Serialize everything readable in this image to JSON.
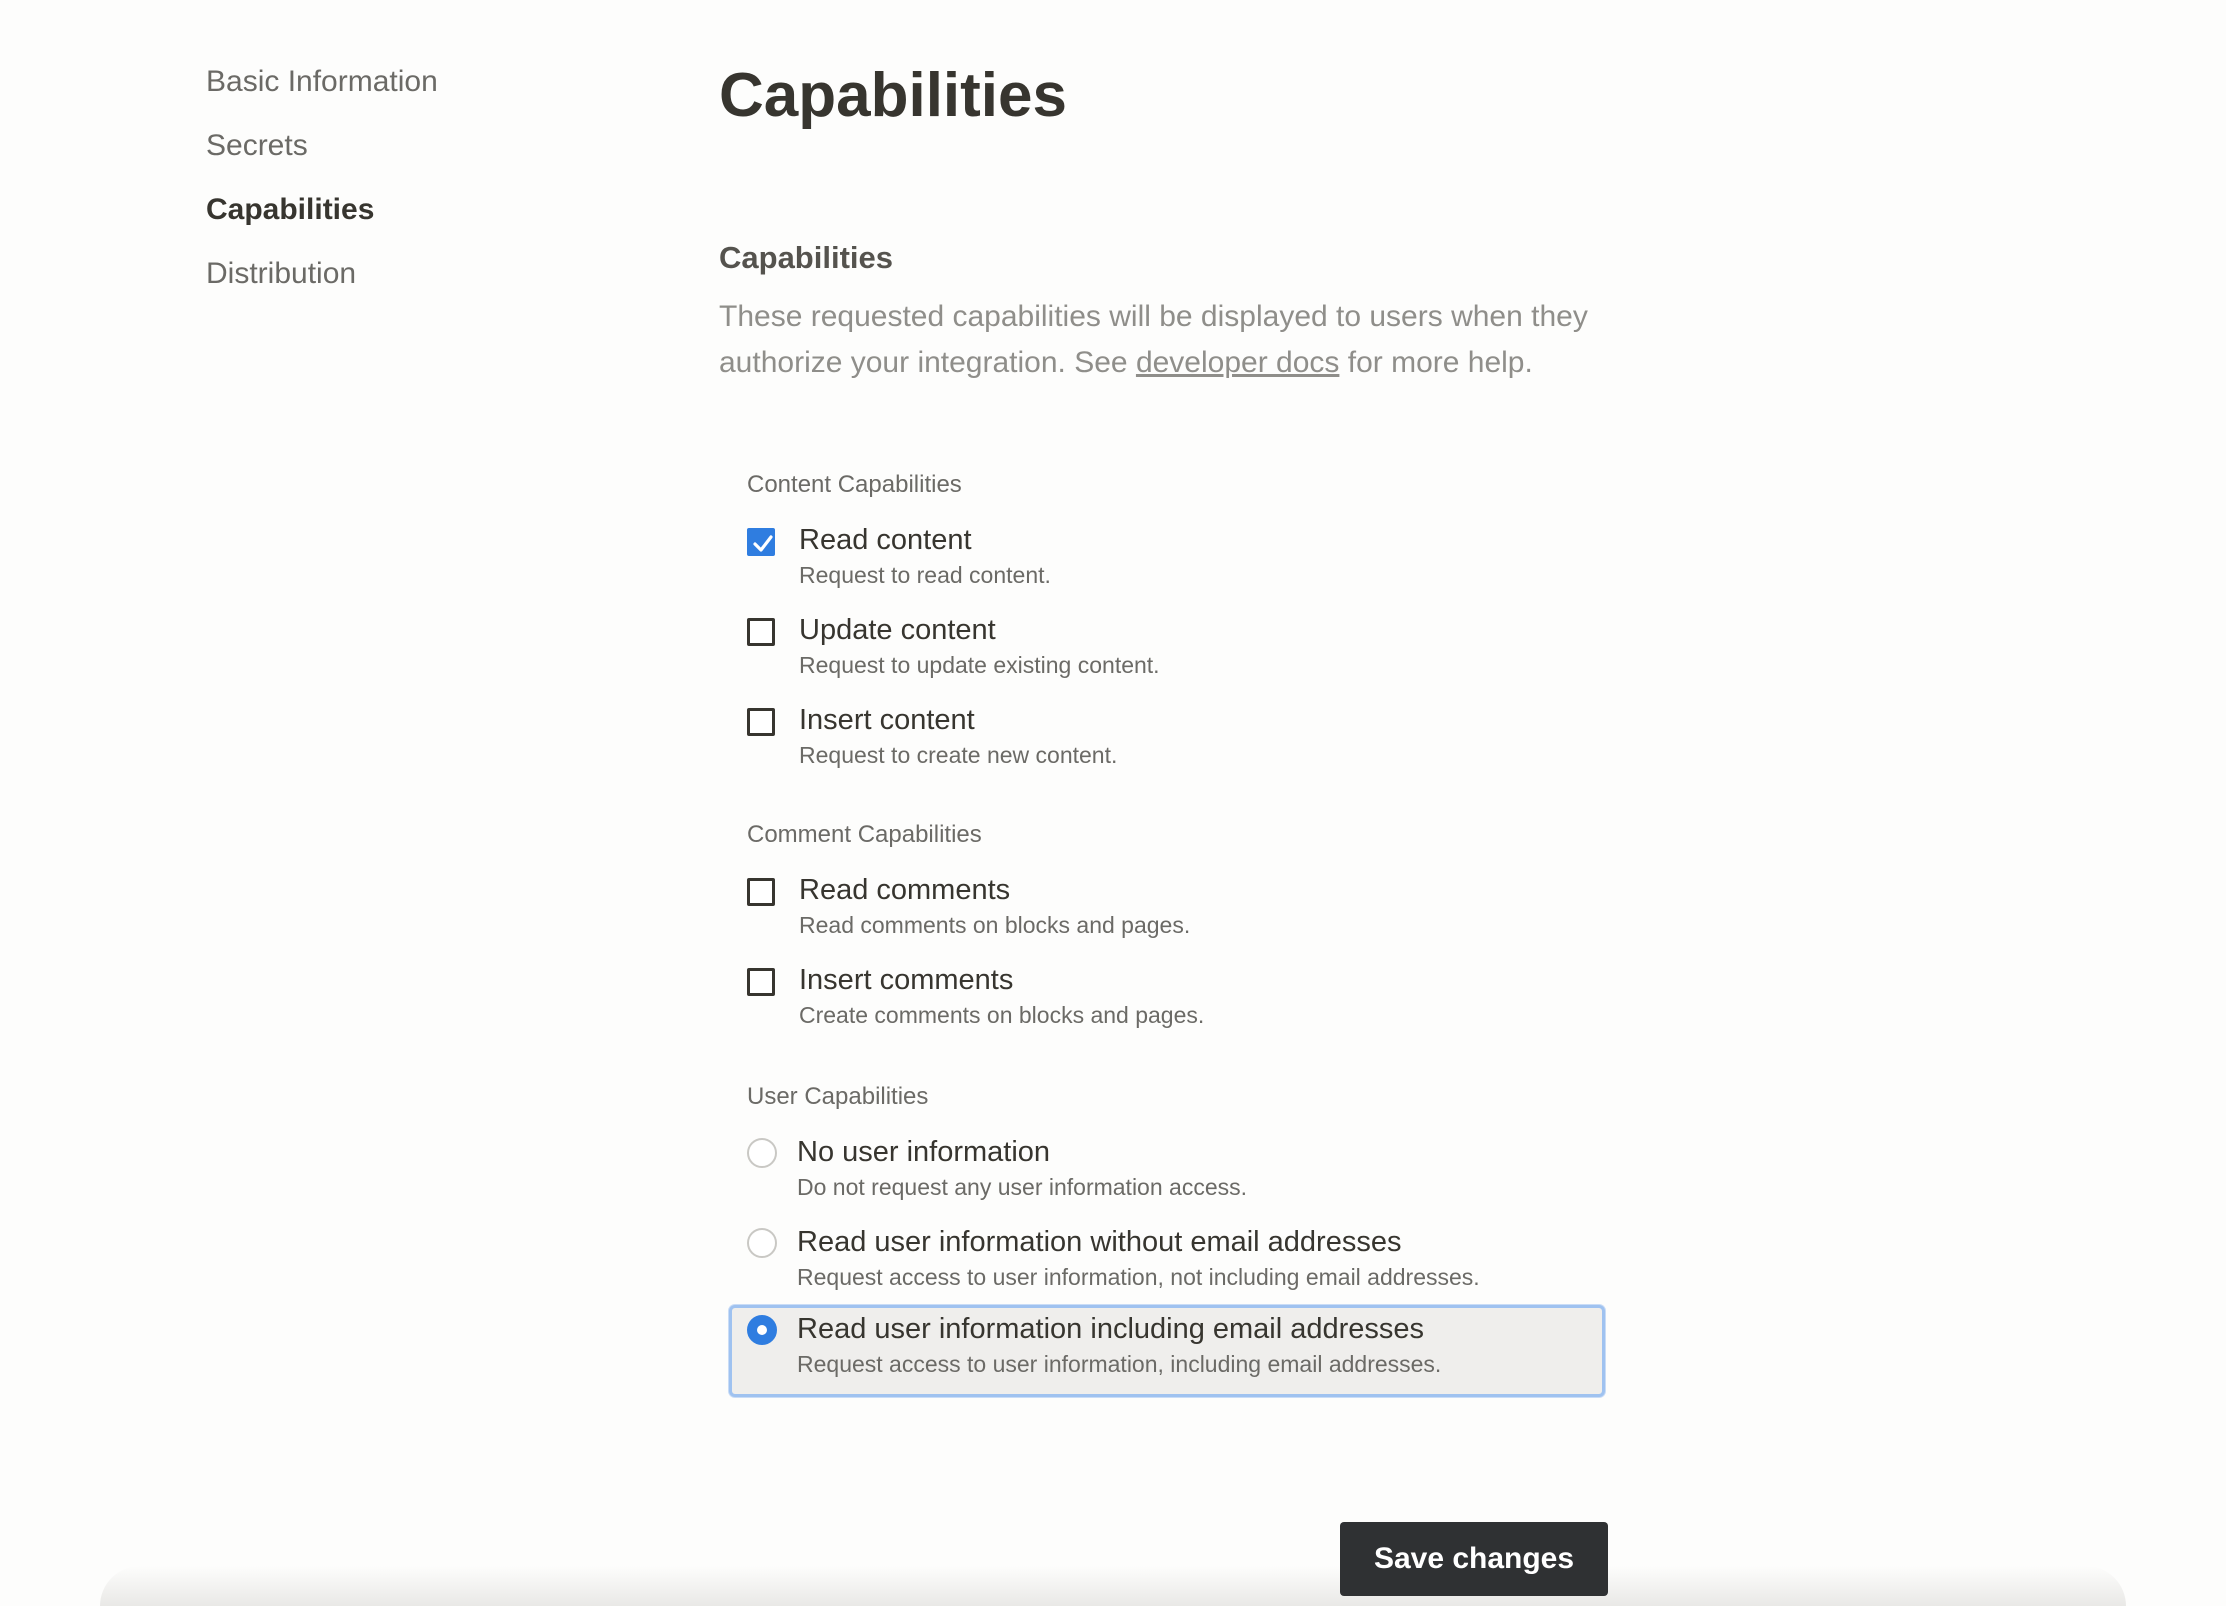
{
  "sidebar": {
    "items": [
      {
        "label": "Basic Information",
        "active": false
      },
      {
        "label": "Secrets",
        "active": false
      },
      {
        "label": "Capabilities",
        "active": true
      },
      {
        "label": "Distribution",
        "active": false
      }
    ]
  },
  "main": {
    "title": "Capabilities",
    "section": {
      "title": "Capabilities",
      "desc_before": "These requested capabilities will be displayed to users when they authorize your integration. See ",
      "link_text": "developer docs",
      "desc_after": " for more help."
    },
    "content": {
      "label": "Content Capabilities",
      "options": [
        {
          "label": "Read content",
          "desc": "Request to read content.",
          "checked": true
        },
        {
          "label": "Update content",
          "desc": "Request to update existing content.",
          "checked": false
        },
        {
          "label": "Insert content",
          "desc": "Request to create new content.",
          "checked": false
        }
      ]
    },
    "comment": {
      "label": "Comment Capabilities",
      "options": [
        {
          "label": "Read comments",
          "desc": "Read comments on blocks and pages.",
          "checked": false
        },
        {
          "label": "Insert comments",
          "desc": "Create comments on blocks and pages.",
          "checked": false
        }
      ]
    },
    "user": {
      "label": "User Capabilities",
      "options": [
        {
          "label": "No user information",
          "desc": "Do not request any user information access.",
          "selected": false
        },
        {
          "label": "Read user information without email addresses",
          "desc": "Request access to user information, not including email addresses.",
          "selected": false
        },
        {
          "label": "Read user information including email addresses",
          "desc": "Request access to user information, including email addresses.",
          "selected": true
        }
      ]
    },
    "save_label": "Save changes"
  },
  "colors": {
    "accent": "#2f7de0",
    "button_bg": "#2f3133",
    "selected_border": "#9fc2f0"
  },
  "icons": {
    "checkmark": "checkmark-icon"
  }
}
